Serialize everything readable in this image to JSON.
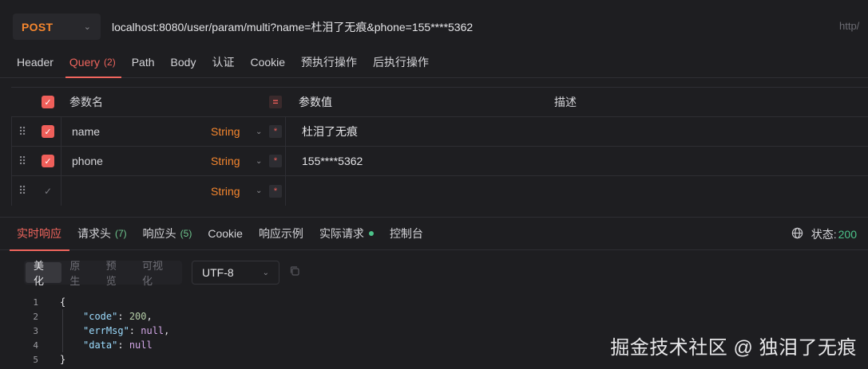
{
  "request": {
    "method": "POST",
    "url": "localhost:8080/user/param/multi?name=杜泪了无痕&phone=155****5362",
    "url_right_fragment": "http/"
  },
  "request_tabs": [
    {
      "label": "Header",
      "count": ""
    },
    {
      "label": "Query",
      "count": "(2)"
    },
    {
      "label": "Path",
      "count": ""
    },
    {
      "label": "Body",
      "count": ""
    },
    {
      "label": "认证",
      "count": ""
    },
    {
      "label": "Cookie",
      "count": ""
    },
    {
      "label": "预执行操作",
      "count": ""
    },
    {
      "label": "后执行操作",
      "count": ""
    }
  ],
  "params_table": {
    "headers": {
      "name": "参数名",
      "value": "参数值",
      "desc": "描述"
    },
    "rows": [
      {
        "name": "name",
        "type": "String",
        "value": "杜泪了无痕",
        "checked": true
      },
      {
        "name": "phone",
        "type": "String",
        "value": "155****5362",
        "checked": true
      },
      {
        "name": "",
        "type": "String",
        "value": "",
        "checked": false
      }
    ]
  },
  "response_tabs": [
    {
      "label": "实时响应",
      "count": ""
    },
    {
      "label": "请求头",
      "count": "(7)"
    },
    {
      "label": "响应头",
      "count": "(5)"
    },
    {
      "label": "Cookie",
      "count": ""
    },
    {
      "label": "响应示例",
      "count": ""
    },
    {
      "label": "实际请求",
      "count": ""
    },
    {
      "label": "控制台",
      "count": ""
    }
  ],
  "status": {
    "label": "状态:",
    "value": "200"
  },
  "format": {
    "buttons": [
      "美化",
      "原生",
      "预览",
      "可视化"
    ],
    "active": "美化",
    "encoding": "UTF-8"
  },
  "code_lines": [
    {
      "num": "1",
      "text": "{"
    },
    {
      "num": "2",
      "key": "\"code\"",
      "sep": ": ",
      "val": "200",
      "valtype": "n",
      "end": ","
    },
    {
      "num": "3",
      "key": "\"errMsg\"",
      "sep": ": ",
      "val": "null",
      "valtype": "kw",
      "end": ","
    },
    {
      "num": "4",
      "key": "\"data\"",
      "sep": ": ",
      "val": "null",
      "valtype": "kw",
      "end": ""
    },
    {
      "num": "5",
      "text": "}"
    }
  ],
  "watermark": "掘金技术社区 @ 独泪了无痕"
}
